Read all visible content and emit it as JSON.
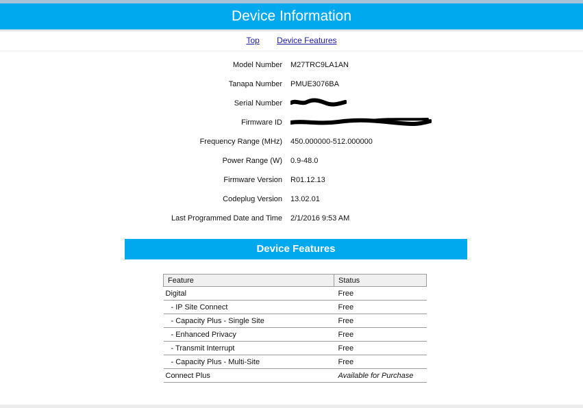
{
  "header": {
    "title": "Device Information"
  },
  "nav": {
    "top": "Top",
    "features": "Device Features"
  },
  "info": {
    "model_number": {
      "label": "Model Number",
      "value": "M27TRC9LA1AN"
    },
    "tanapa_number": {
      "label": "Tanapa Number",
      "value": "PMUE3076BA"
    },
    "serial_number": {
      "label": "Serial Number",
      "value": ""
    },
    "firmware_id": {
      "label": "Firmware ID",
      "value": ""
    },
    "frequency_range": {
      "label": "Frequency Range (MHz)",
      "value": "450.000000-512.000000"
    },
    "power_range": {
      "label": "Power Range (W)",
      "value": "0.9-48.0"
    },
    "firmware_version": {
      "label": "Firmware Version",
      "value": "R01.12.13"
    },
    "codeplug_version": {
      "label": "Codeplug Version",
      "value": "13.02.01"
    },
    "last_programmed": {
      "label": "Last Programmed Date and Time",
      "value": "2/1/2016 9:53 AM"
    }
  },
  "features_section": {
    "title": "Device Features",
    "columns": [
      "Feature",
      "Status"
    ],
    "rows": [
      {
        "feature": "Digital",
        "status": "Free"
      },
      {
        "feature": "- IP Site Connect",
        "status": "Free"
      },
      {
        "feature": "- Capacity Plus - Single Site",
        "status": "Free"
      },
      {
        "feature": "- Enhanced Privacy",
        "status": "Free"
      },
      {
        "feature": "- Transmit Interrupt",
        "status": "Free"
      },
      {
        "feature": "- Capacity Plus - Multi-Site",
        "status": "Free"
      },
      {
        "feature": "Connect Plus",
        "status": "Available for Purchase"
      }
    ]
  },
  "colors": {
    "accent": "#00a9ee",
    "link": "#1a1aa6"
  }
}
